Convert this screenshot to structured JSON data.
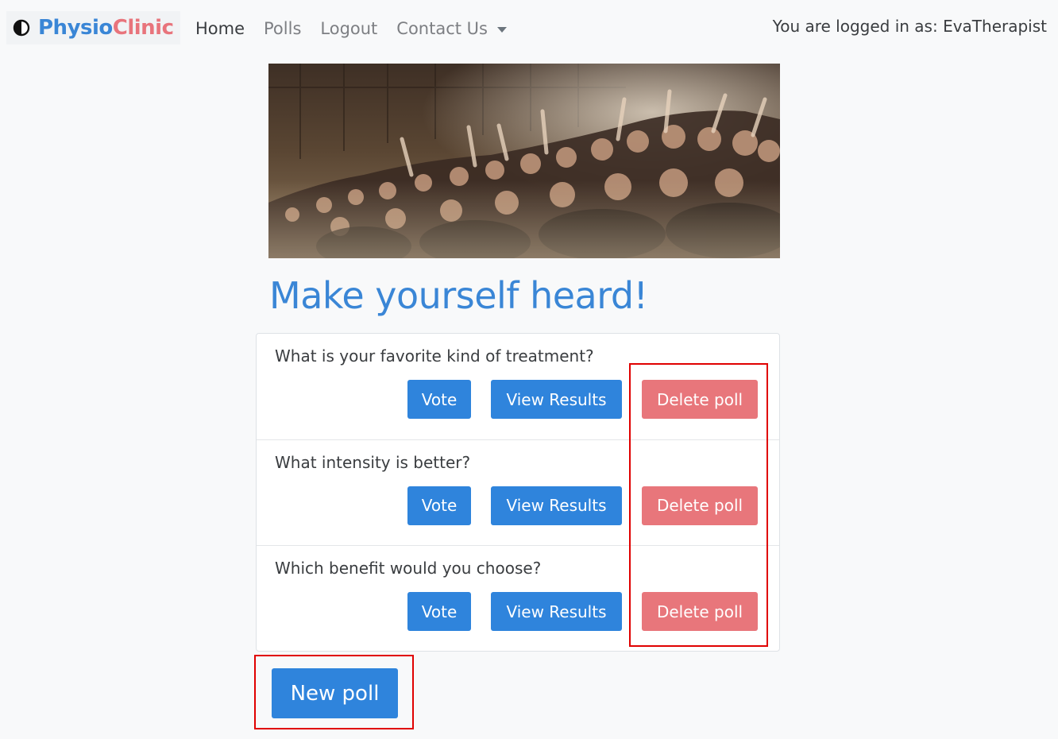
{
  "brand": {
    "name_part1": "Physio",
    "name_part2": "Clinic",
    "icon": "contrast-icon"
  },
  "nav": {
    "items": [
      {
        "label": "Home",
        "active": true
      },
      {
        "label": "Polls",
        "active": false
      },
      {
        "label": "Logout",
        "active": false
      },
      {
        "label": "Contact Us",
        "active": false,
        "dropdown": true
      }
    ],
    "user_status": "You are logged in as: EvaTherapist"
  },
  "hero": {
    "image": "crowd-raising-hands-photo"
  },
  "page_title": "Make yourself heard!",
  "polls": [
    {
      "question": "What is your favorite kind of treatment?",
      "vote_label": "Vote",
      "results_label": "View Results",
      "delete_label": "Delete poll"
    },
    {
      "question": "What intensity is better?",
      "vote_label": "Vote",
      "results_label": "View Results",
      "delete_label": "Delete poll"
    },
    {
      "question": "Which benefit would you choose?",
      "vote_label": "Vote",
      "results_label": "View Results",
      "delete_label": "Delete poll"
    }
  ],
  "new_poll_label": "New poll",
  "colors": {
    "primary": "#2f84dc",
    "danger": "#e8767b",
    "brand_blue": "#3a86d6",
    "brand_red": "#e8747c",
    "highlight": "#e00000"
  }
}
